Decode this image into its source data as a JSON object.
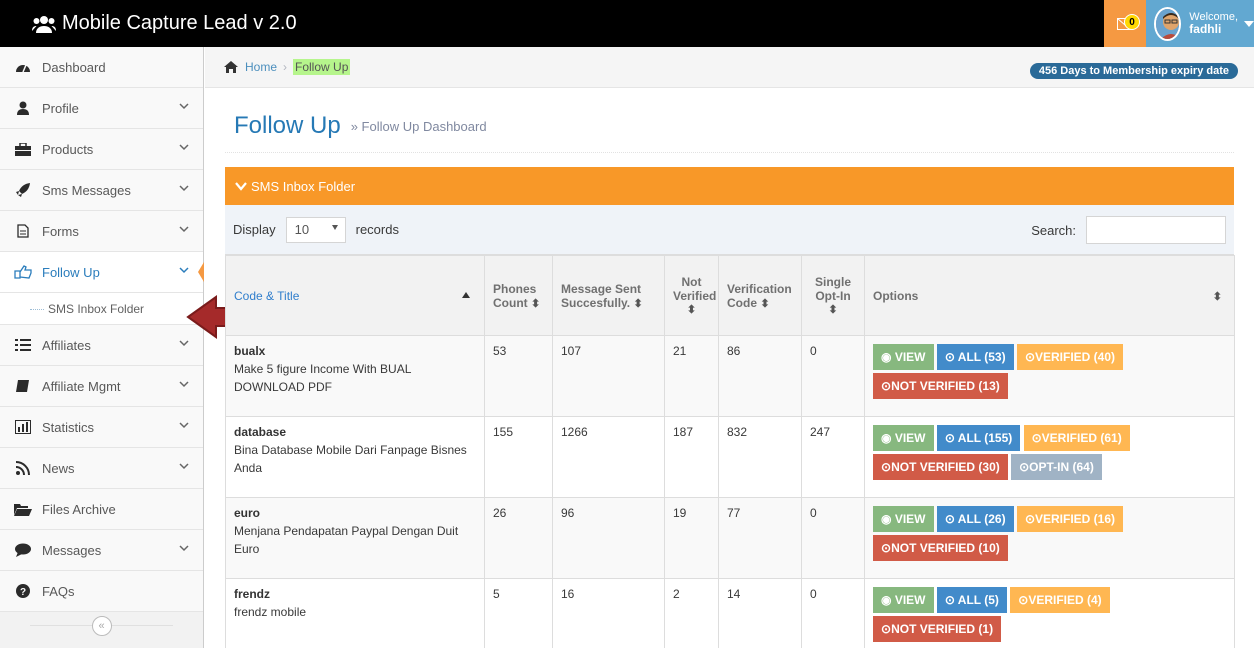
{
  "app": {
    "title": "Mobile Capture Lead v 2.0",
    "mail_count": "0",
    "welcome_text": "Welcome,",
    "username": "fadhli"
  },
  "sidebar": {
    "items": [
      {
        "label": "Dashboard",
        "icon": "tachometer-icon"
      },
      {
        "label": "Profile",
        "icon": "user-icon"
      },
      {
        "label": "Products",
        "icon": "briefcase-icon"
      },
      {
        "label": "Sms Messages",
        "icon": "rocket-icon"
      },
      {
        "label": "Forms",
        "icon": "file-icon"
      },
      {
        "label": "Follow Up",
        "icon": "share-hand-icon"
      },
      {
        "label": "Affiliates",
        "icon": "list-icon"
      },
      {
        "label": "Affiliate Mgmt",
        "icon": "pencil-box-icon"
      },
      {
        "label": "Statistics",
        "icon": "bar-chart-icon"
      },
      {
        "label": "News",
        "icon": "rss-icon"
      },
      {
        "label": "Files Archive",
        "icon": "folder-open-icon"
      },
      {
        "label": "Messages",
        "icon": "comment-icon"
      },
      {
        "label": "FAQs",
        "icon": "question-circle-icon"
      }
    ],
    "sub_item": "SMS Inbox Folder",
    "collapse_glyph": "«"
  },
  "breadcrumb": {
    "home": "Home",
    "sep": "›",
    "current": "Follow Up",
    "expiry": "456 Days to Membership expiry date"
  },
  "page": {
    "title": "Follow Up",
    "subtitle": "» Follow Up Dashboard"
  },
  "widget": {
    "title": "SMS Inbox Folder",
    "display_label": "Display",
    "records_value": "10",
    "records_label": "records",
    "search_label": "Search:"
  },
  "table": {
    "headers": {
      "code": "Code & Title",
      "phones_1": "Phones",
      "phones_2": "Count",
      "msg_1": "Message Sent",
      "msg_2": "Succesfully.",
      "not_1": "Not",
      "not_2": "Verified",
      "ver_1": "Verification",
      "ver_2": "Code",
      "single_1": "Single",
      "single_2": "Opt-In",
      "options": "Options"
    },
    "rows": [
      {
        "code": "bualx",
        "title": "Make 5 figure Income With BUAL DOWNLOAD PDF",
        "phones": "53",
        "sent": "107",
        "not_verified": "21",
        "verification": "86",
        "optin": "0",
        "btn_view": "VIEW",
        "btn_all": "ALL (53)",
        "btn_verified": "VERIFIED (40)",
        "btn_not": "NOT VERIFIED (13)",
        "btn_optin": ""
      },
      {
        "code": "database",
        "title": "Bina Database Mobile Dari Fanpage Bisnes Anda",
        "phones": "155",
        "sent": "1266",
        "not_verified": "187",
        "verification": "832",
        "optin": "247",
        "btn_view": "VIEW",
        "btn_all": "ALL (155)",
        "btn_verified": "VERIFIED (61)",
        "btn_not": "NOT VERIFIED (30)",
        "btn_optin": "OPT-IN (64)"
      },
      {
        "code": "euro",
        "title": "Menjana Pendapatan Paypal Dengan Duit Euro",
        "phones": "26",
        "sent": "96",
        "not_verified": "19",
        "verification": "77",
        "optin": "0",
        "btn_view": "VIEW",
        "btn_all": "ALL (26)",
        "btn_verified": "VERIFIED (16)",
        "btn_not": "NOT VERIFIED (10)",
        "btn_optin": ""
      },
      {
        "code": "frendz",
        "title": "frendz mobile",
        "phones": "5",
        "sent": "16",
        "not_verified": "2",
        "verification": "14",
        "optin": "0",
        "btn_view": "VIEW",
        "btn_all": "ALL (5)",
        "btn_verified": "VERIFIED (4)",
        "btn_not": "NOT VERIFIED (1)",
        "btn_optin": ""
      }
    ]
  },
  "colors": {
    "accent_orange": "#f89828",
    "header_black": "#000000",
    "link_blue": "#2679b5",
    "arrow_red": "#a52a2a"
  }
}
